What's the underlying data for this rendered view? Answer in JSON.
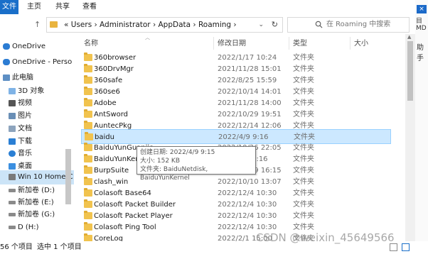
{
  "ribbon": {
    "tabs": [
      "文件",
      "主页",
      "共享",
      "查看"
    ]
  },
  "address": {
    "breadcrumb": "« Users › Administrator › AppData › Roaming ›"
  },
  "search": {
    "placeholder": "在 Roaming 中搜索"
  },
  "rightcut": {
    "text1": "目MD",
    "text2": "助手"
  },
  "nav": {
    "items": [
      {
        "label": "OneDrive",
        "icon": "cloud-icon"
      },
      {
        "label": "OneDrive - Perso",
        "icon": "cloud-icon"
      },
      {
        "label": "此电脑",
        "icon": "computer-icon"
      },
      {
        "label": "3D 对象",
        "icon": "cube-icon"
      },
      {
        "label": "视频",
        "icon": "video-icon"
      },
      {
        "label": "图片",
        "icon": "picture-icon"
      },
      {
        "label": "文档",
        "icon": "document-icon"
      },
      {
        "label": "下载",
        "icon": "download-icon"
      },
      {
        "label": "音乐",
        "icon": "music-icon"
      },
      {
        "label": "桌面",
        "icon": "desktop-icon"
      },
      {
        "label": "Win 10 Home C",
        "icon": "drive-icon"
      },
      {
        "label": "新加卷 (D:)",
        "icon": "drive-icon"
      },
      {
        "label": "新加卷 (E:)",
        "icon": "drive-icon"
      },
      {
        "label": "新加卷 (G:)",
        "icon": "drive-icon"
      },
      {
        "label": "D (H:)",
        "icon": "drive-icon"
      }
    ]
  },
  "columns": {
    "name": "名称",
    "date": "修改日期",
    "type": "类型",
    "size": "大小"
  },
  "files": [
    {
      "name": "360browser",
      "date": "2022/1/17 10:24",
      "type": "文件夹"
    },
    {
      "name": "360DrvMgr",
      "date": "2021/11/28 15:01",
      "type": "文件夹"
    },
    {
      "name": "360safe",
      "date": "2022/8/25 15:59",
      "type": "文件夹"
    },
    {
      "name": "360se6",
      "date": "2022/10/14 14:01",
      "type": "文件夹"
    },
    {
      "name": "Adobe",
      "date": "2021/11/28 14:00",
      "type": "文件夹"
    },
    {
      "name": "AntSword",
      "date": "2022/10/29 19:51",
      "type": "文件夹"
    },
    {
      "name": "AuntecPkg",
      "date": "2022/12/14 12:06",
      "type": "文件夹"
    },
    {
      "name": "baidu",
      "date": "2022/4/9 9:16",
      "type": "文件夹"
    },
    {
      "name": "BaiduYunGuanjia",
      "date": "2022/10/26 22:05",
      "type": "文件夹"
    },
    {
      "name": "BaiduYunKernel",
      "date": "2022/4/9 9:16",
      "type": "文件夹"
    },
    {
      "name": "BurpSuite",
      "date": "2022/10/29 16:15",
      "type": "文件夹"
    },
    {
      "name": "clash_win",
      "date": "2022/10/10 13:07",
      "type": "文件夹"
    },
    {
      "name": "Colasoft Base64",
      "date": "2022/12/4 10:30",
      "type": "文件夹"
    },
    {
      "name": "Colasoft Packet Builder",
      "date": "2022/12/4 10:30",
      "type": "文件夹"
    },
    {
      "name": "Colasoft Packet Player",
      "date": "2022/12/4 10:30",
      "type": "文件夹"
    },
    {
      "name": "Colasoft Ping Tool",
      "date": "2022/12/4 10:30",
      "type": "文件夹"
    },
    {
      "name": "CoreLog",
      "date": "2022/2/1 15:00",
      "type": "文件夹"
    }
  ],
  "tooltip": {
    "line1": "创建日期: 2022/4/9 9:15",
    "line2": "大小: 152 KB",
    "line3": "文件夹: BaiduNetdisk, BaiduYunKernel"
  },
  "status": {
    "count": "56 个项目",
    "selected": "选中 1 个项目"
  },
  "watermark": "CSDN @weixin_45649566",
  "colors": {
    "selection": "#cce8ff",
    "accent": "#1a6fc9",
    "folder": "#f1c34e"
  }
}
